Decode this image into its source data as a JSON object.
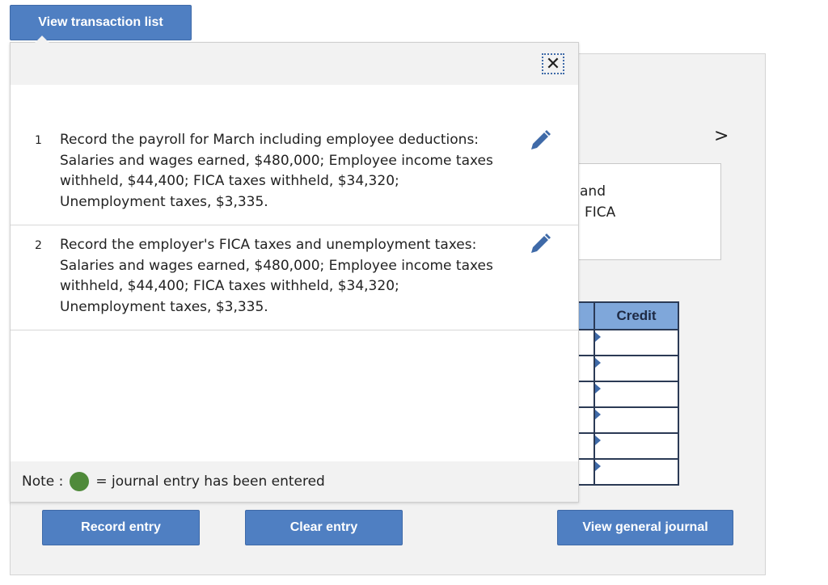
{
  "header": {
    "view_transaction_list_label": "View transaction list"
  },
  "background": {
    "description_partial_line1": "and",
    "description_partial_line2": "FICA",
    "next_icon": "chevron-right-icon",
    "grid_header_credit": "Credit",
    "grid_rows": 6
  },
  "popup": {
    "close_icon": "close-icon",
    "transactions": [
      {
        "number": "1",
        "text": "Record the payroll for March including employee deductions: Salaries and wages earned, $480,000; Employee income taxes withheld, $44,400; FICA taxes withheld, $34,320; Unemployment taxes, $3,335.",
        "edit_icon": "pencil-icon"
      },
      {
        "number": "2",
        "text": "Record the employer's FICA taxes and unemployment taxes: Salaries and wages earned, $480,000; Employee income taxes withheld, $44,400; FICA taxes withheld, $34,320; Unemployment taxes, $3,335.",
        "edit_icon": "pencil-icon"
      }
    ],
    "note_label": "Note :",
    "note_text": "= journal entry has been entered"
  },
  "footer": {
    "record_entry_label": "Record entry",
    "clear_entry_label": "Clear entry",
    "view_general_journal_label": "View general journal"
  },
  "colors": {
    "button_blue": "#4f7fc2",
    "header_blue": "#7fa7da",
    "entered_dot_green": "#4f8a3a",
    "pencil_blue": "#3f6aa8"
  }
}
